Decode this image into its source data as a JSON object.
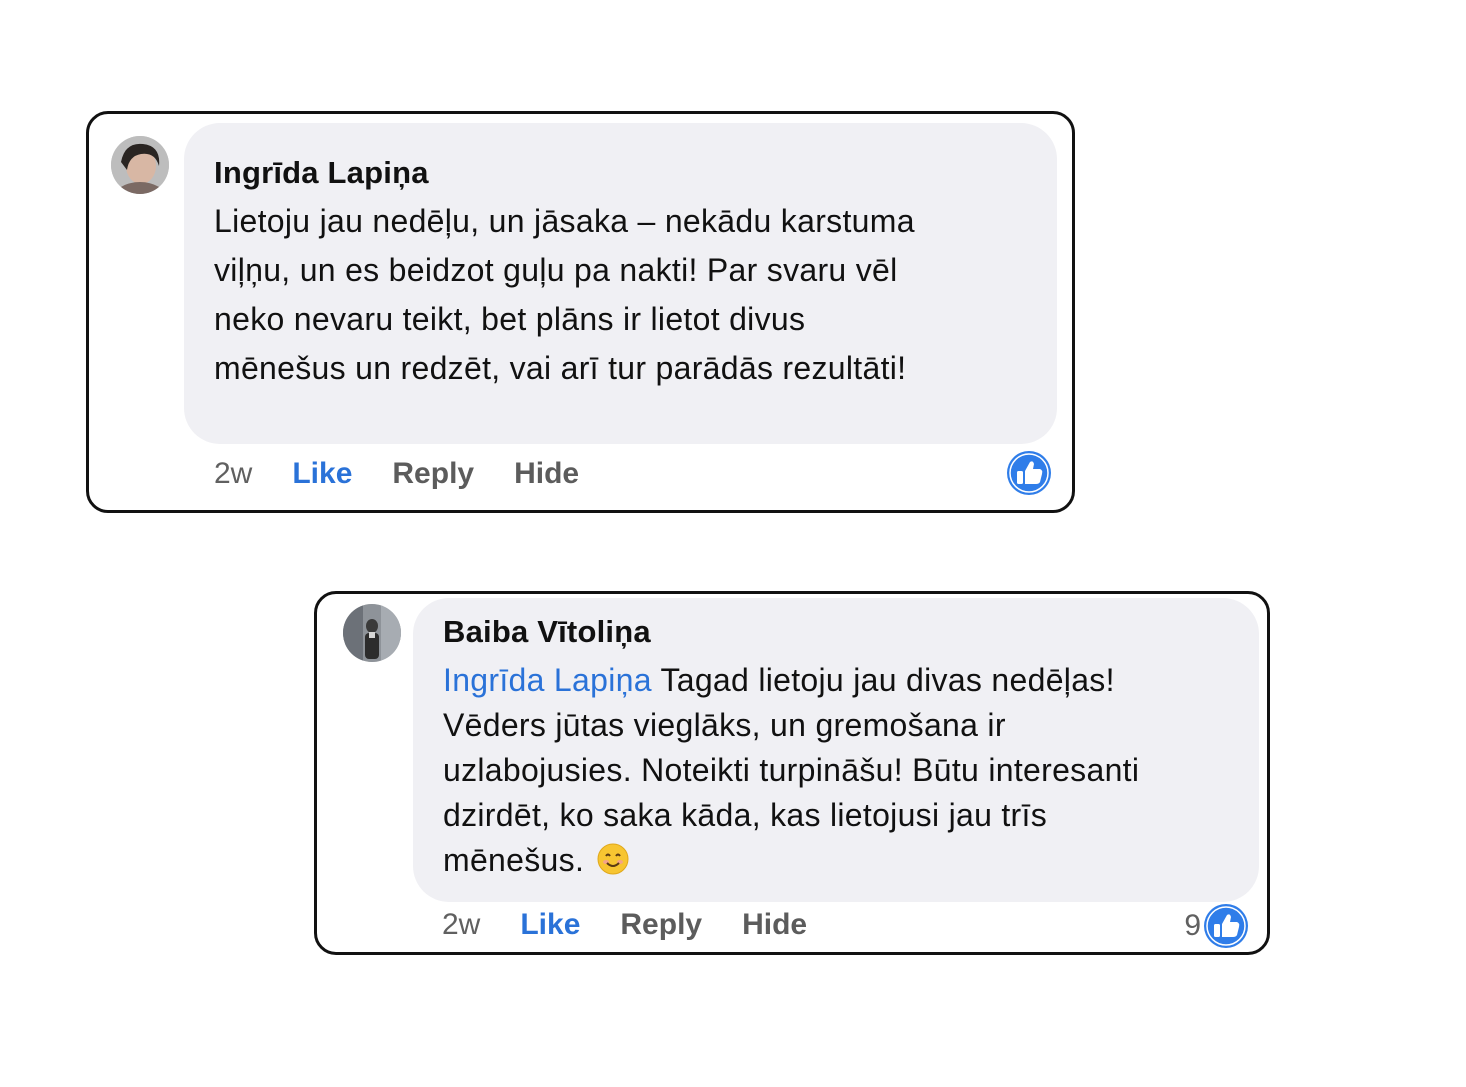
{
  "comments": [
    {
      "author": "Ingrīda Lapiņa",
      "mention": "",
      "text": "Lietoju jau nedēļu, un jāsaka – nekādu karstuma viļņu, un es beidzot guļu pa nakti!  Par svaru vēl neko nevaru teikt, bet plāns ir lietot divus mēnešus un redzēt, vai arī tur parādās rezultāti!",
      "time": "2w",
      "like_label": "Like",
      "reply_label": "Reply",
      "hide_label": "Hide",
      "reaction_count": "",
      "reaction_icon": "thumbs-up-icon"
    },
    {
      "author": "Baiba Vītoliņa",
      "mention": "Ingrīda Lapiņa",
      "text": "Tagad lietoju jau divas nedēļas! Vēders jūtas vieglāks, un gremošana ir uzlabojusies. Noteikti turpināšu! Būtu interesanti dzirdēt, ko saka kāda, kas lietojusi jau trīs mēnešus.",
      "emoji": "smiling-face-icon",
      "time": "2w",
      "like_label": "Like",
      "reply_label": "Reply",
      "hide_label": "Hide",
      "reaction_count": "9",
      "reaction_icon": "thumbs-up-icon"
    }
  ],
  "colors": {
    "accent": "#2a72d8",
    "bubble": "#f0f0f4",
    "border": "#111111",
    "muted": "#5c5c5c"
  }
}
